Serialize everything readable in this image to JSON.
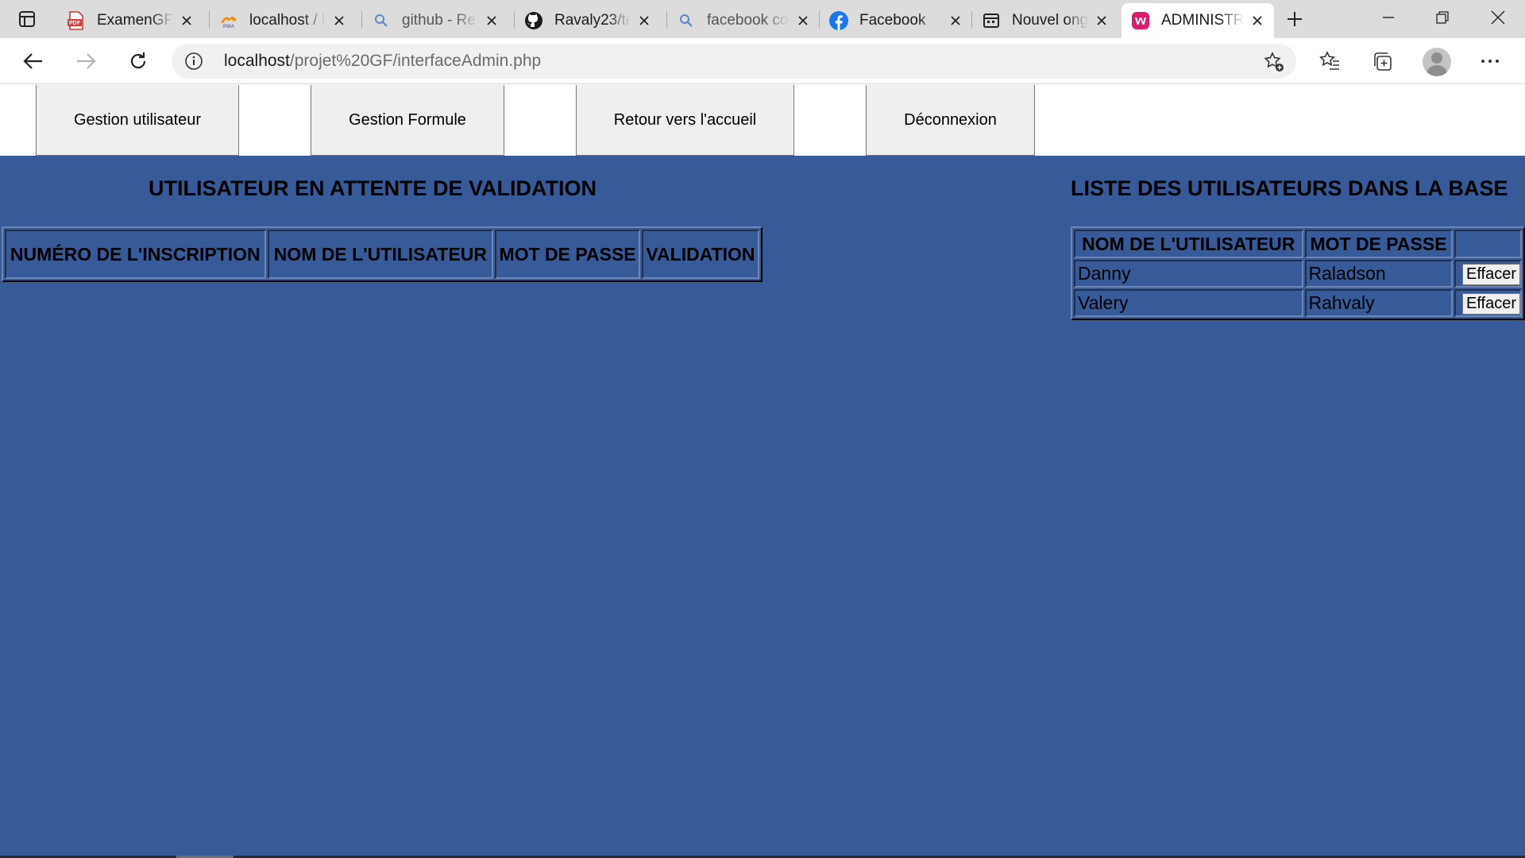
{
  "browser": {
    "tabs": [
      {
        "title": "ExamenGF2",
        "icon": "pdf-icon"
      },
      {
        "title": "localhost / l",
        "icon": "phpmyadmin-icon"
      },
      {
        "title": "github - Re",
        "icon": "search-icon"
      },
      {
        "title": "Ravaly23/te",
        "icon": "github-icon"
      },
      {
        "title": "facebook co",
        "icon": "search-icon"
      },
      {
        "title": "Facebook",
        "icon": "facebook-icon"
      },
      {
        "title": "Nouvel ong",
        "icon": "newtab-icon"
      },
      {
        "title": "ADMINISTR",
        "icon": "wamp-icon"
      }
    ],
    "active_tab_index": 7,
    "address": {
      "host": "localhost",
      "path": "/projet%20GF/interfaceAdmin.php"
    }
  },
  "nav": {
    "buttons": [
      {
        "label": "Gestion utilisateur"
      },
      {
        "label": "Gestion Formule"
      },
      {
        "label": "Retour vers l'accueil"
      },
      {
        "label": "Déconnexion"
      }
    ]
  },
  "pending": {
    "title": "UTILISATEUR EN ATTENTE DE VALIDATION",
    "headers": [
      "NUMÉRO DE L'INSCRIPTION",
      "NOM DE L'UTILISATEUR",
      "MOT DE PASSE",
      "VALIDATION"
    ],
    "rows": []
  },
  "users": {
    "title": "LISTE DES UTILISATEURS DANS LA BASE",
    "headers": [
      "NOM DE L'UTILISATEUR",
      "MOT DE PASSE"
    ],
    "rows": [
      {
        "name": "Danny",
        "password": "Raladson",
        "action": "Effacer"
      },
      {
        "name": "Valery",
        "password": "Rahvaly",
        "action": "Effacer"
      }
    ]
  },
  "colors": {
    "page_background": "#375a98",
    "tabbar_background": "#dcdcdc"
  }
}
